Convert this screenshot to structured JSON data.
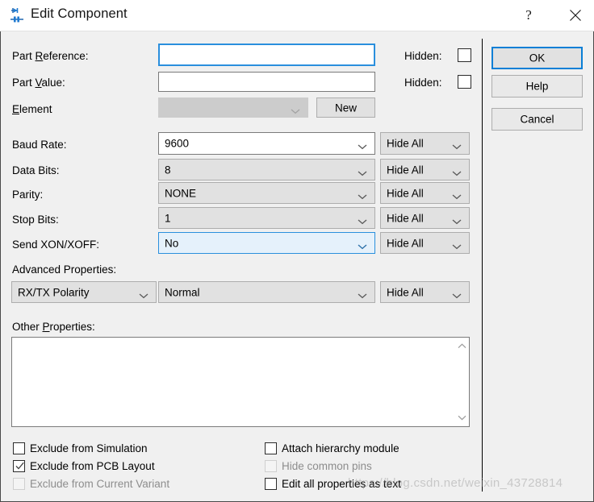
{
  "window": {
    "title": "Edit Component",
    "icon": "component-diode-icon",
    "help_button": "?",
    "close_button": "close-icon",
    "accent_color": "#2a8fdd",
    "face_color": "#f0f0f0",
    "control_color": "#e1e1e1"
  },
  "form": {
    "part_reference": {
      "label_pre": "Part ",
      "label_accel": "R",
      "label_post": "eference:",
      "value": "",
      "hidden_label": "Hidden:",
      "hidden_checked": false
    },
    "part_value": {
      "label_pre": "Part ",
      "label_accel": "V",
      "label_post": "alue:",
      "value": "",
      "hidden_label": "Hidden:",
      "hidden_checked": false
    },
    "element": {
      "label_pre": "",
      "label_accel": "E",
      "label_post": "lement",
      "value": "",
      "disabled": true,
      "new_button": "New"
    },
    "properties": [
      {
        "label": "Baud Rate:",
        "value": "9600",
        "visibility": "Hide All",
        "editable": true,
        "focused": false
      },
      {
        "label": "Data Bits:",
        "value": "8",
        "visibility": "Hide All",
        "editable": false,
        "focused": false
      },
      {
        "label": "Parity:",
        "value": "NONE",
        "visibility": "Hide All",
        "editable": false,
        "focused": false
      },
      {
        "label": "Stop Bits:",
        "value": "1",
        "visibility": "Hide All",
        "editable": false,
        "focused": false
      },
      {
        "label": "Send XON/XOFF:",
        "value": "No",
        "visibility": "Hide All",
        "editable": false,
        "focused": true
      }
    ],
    "advanced": {
      "label": "Advanced Properties:",
      "name": "RX/TX Polarity",
      "value": "Normal",
      "visibility": "Hide All"
    },
    "other": {
      "label_pre": "Other ",
      "label_accel": "P",
      "label_post": "roperties:",
      "value": ""
    }
  },
  "buttons": {
    "ok": "OK",
    "help": "Help",
    "cancel": "Cancel"
  },
  "footer": {
    "left": [
      {
        "label": "Exclude from Simulation",
        "checked": false,
        "disabled": false
      },
      {
        "label": "Exclude from PCB Layout",
        "checked": true,
        "disabled": false
      },
      {
        "label": "Exclude from Current Variant",
        "checked": false,
        "disabled": true
      }
    ],
    "right": [
      {
        "label": "Attach hierarchy module",
        "checked": false,
        "disabled": false
      },
      {
        "label": "Hide common pins",
        "checked": false,
        "disabled": true
      },
      {
        "label": "Edit all properties as text",
        "checked": false,
        "disabled": false
      }
    ]
  },
  "watermark": "https://blog.csdn.net/weixin_43728814"
}
